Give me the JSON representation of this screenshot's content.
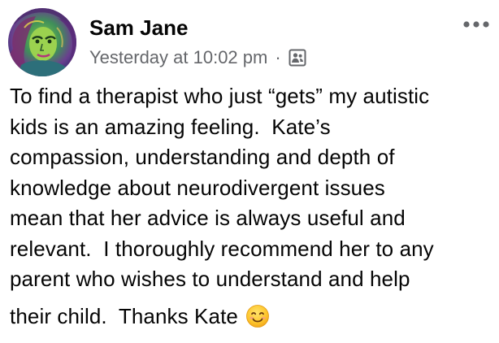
{
  "post": {
    "author_name": "Sam Jane",
    "timestamp": "Yesterday at 10:02 pm",
    "separator": "·",
    "audience_icon": "friends-audience-icon",
    "more_icon": "more-options-icon",
    "body_lines": [
      "To find a therapist who just “gets” my autistic",
      "kids is an amazing feeling.  Kate’s",
      "compassion, understanding and depth of",
      "knowledge about neurodivergent issues",
      "mean that her advice is always useful and",
      "relevant.  I thoroughly recommend her to any",
      "parent who wishes to understand and help",
      "their child.  Thanks Kate "
    ],
    "emoji": "smiling-face-emoji"
  }
}
